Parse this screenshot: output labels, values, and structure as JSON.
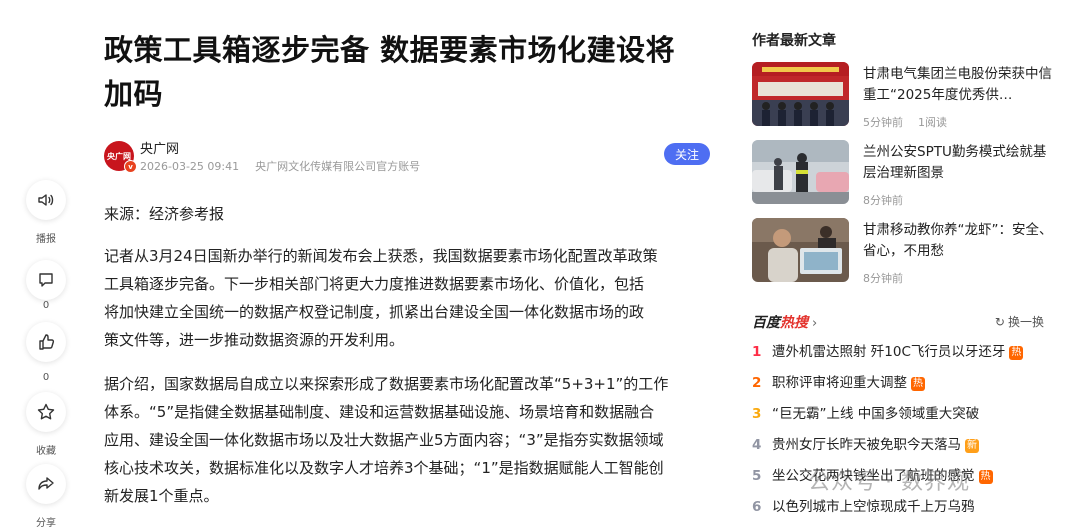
{
  "article": {
    "title_line1": "政策工具箱逐步完备 数据要素市场化建设将",
    "title_line2": "加码",
    "author": {
      "avatar_text": "央广网",
      "name": "央广网",
      "time": "2026-03-25 09:41",
      "org": "央广网文化传媒有限公司官方账号",
      "follow_label": "关注"
    },
    "paragraphs": [
      "来源：经济参考报",
      "记者从3月24日国新办举行的新闻发布会上获悉，我国数据要素市场化配置改革政策工具箱逐步完备。下一步相关部门将更大力度推进数据要素市场化、价值化，包括将加快建立全国统一的数据产权登记制度，抓紧出台建设全国一体化数据市场的政策文件等，进一步推动数据资源的开发利用。",
      "据介绍，国家数据局自成立以来探索形成了数据要素市场化配置改革“5+3+1”的工作体系。“5”是指健全数据基础制度、建设和运营数据基础设施、场景培育和数据融合应用、建设全国一体化数据市场以及壮大数据产业5方面内容；“3”是指夯实数据领域核心技术攻关，数据标准化以及数字人才培养3个基础；“1”是指数据赋能人工智能创新发展1个重点。"
    ],
    "para_lines": [
      [
        "来源：经济参考报"
      ],
      [
        "记者从3月24日国新办举行的新闻发布会上获悉，我国数据要素市场化配置改革政策",
        "工具箱逐步完备。下一步相关部门将更大力度推进数据要素市场化、价值化，包括",
        "将加快建立全国统一的数据产权登记制度，抓紧出台建设全国一体化数据市场的政",
        "策文件等，进一步推动数据资源的开发利用。"
      ],
      [
        "据介绍，国家数据局自成立以来探索形成了数据要素市场化配置改革“5+3+1”的工作",
        "体系。“5”是指健全数据基础制度、建设和运营数据基础设施、场景培育和数据融合",
        "应用、建设全国一体化数据市场以及壮大数据产业5方面内容；“3”是指夯实数据领域",
        "核心技术攻关，数据标准化以及数字人才培养3个基础；“1”是指数据赋能人工智能创",
        "新发展1个重点。"
      ]
    ]
  },
  "rail": {
    "broadcast_label": "播报",
    "comment_count": "0",
    "like_count": "0",
    "collect_label": "收藏",
    "share_label": "分享"
  },
  "sidebar": {
    "latest_heading": "作者最新文章",
    "latest": [
      {
        "title": "甘肃电气集团兰电股份荣获中信重工“2025年度优秀供…",
        "time": "5分钟前",
        "reads": "1阅读"
      },
      {
        "title": "兰州公安SPTU勤务模式绘就基层治理新图景",
        "time": "8分钟前",
        "reads": ""
      },
      {
        "title": "甘肃移动教你养“龙虾”：安全、省心，不用愁",
        "time": "8分钟前",
        "reads": ""
      }
    ],
    "hot": {
      "logo_prefix": "百度",
      "logo_suffix": "热搜",
      "refresh_label": "换一换",
      "items": [
        {
          "rank": "1",
          "text": "遭外机雷达照射 歼10C飞行员以牙还牙",
          "tag": "热"
        },
        {
          "rank": "2",
          "text": "职称评审将迎重大调整",
          "tag": "热"
        },
        {
          "rank": "3",
          "text": "“巨无霸”上线 中国多领域重大突破",
          "tag": ""
        },
        {
          "rank": "4",
          "text": "贵州女厅长昨天被免职今天落马",
          "tag": "新"
        },
        {
          "rank": "5",
          "text": "坐公交花两块钱坐出了航班的感觉",
          "tag": "热"
        },
        {
          "rank": "6",
          "text": "以色列城市上空惊现成千上万乌鸦",
          "tag": ""
        }
      ]
    }
  },
  "watermark": "公众号 · 数界观"
}
